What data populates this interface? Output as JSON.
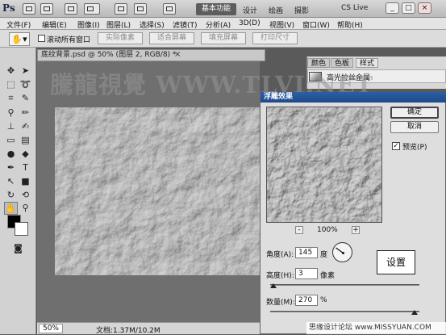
{
  "app": {
    "logo": "Ps",
    "workspace_active": "基本功能",
    "workspace_links": [
      "设计",
      "绘画",
      "摄影"
    ],
    "cs_live": "CS Live"
  },
  "window_controls": [
    "_",
    "□",
    "×"
  ],
  "menu": [
    "文件(F)",
    "编辑(E)",
    "图像(I)",
    "图层(L)",
    "选择(S)",
    "滤镜(T)",
    "分析(A)",
    "3D(D)",
    "视图(V)",
    "窗口(W)",
    "帮助(H)"
  ],
  "options": {
    "scroll_all_label": "滚动所有窗口",
    "buttons": [
      "实际像素",
      "适合屏幕",
      "填充屏幕",
      "打印尺寸"
    ]
  },
  "document": {
    "tab_title": "底纹背景.psd @ 50% (图层 2, RGB/8) *",
    "close_glyph": "×",
    "zoom": "50%",
    "doc_info": "文档:1.37M/10.2M"
  },
  "panels": {
    "tabs": [
      "颜色",
      "色板",
      "样式"
    ],
    "preset_label": "高光拉丝金属"
  },
  "watermark": "騰龍視覺 WWW.TLVI.NET",
  "dialog": {
    "title": "浮雕效果",
    "ok": "确定",
    "cancel": "取消",
    "preview_label": "预览(P)",
    "preview_checked": "✓",
    "zoom_minus": "-",
    "zoom_plus": "+",
    "zoom_pct": "100%",
    "angle_label": "角度(A):",
    "angle_value": "145",
    "angle_unit": "度",
    "height_label": "高度(H):",
    "height_value": "3",
    "height_unit": "像素",
    "amount_label": "数量(M):",
    "amount_value": "270",
    "amount_unit": "%",
    "callout": "设置"
  },
  "footer_watermark": "思缘设计论坛 www.MISSYUAN.COM",
  "icons": [
    "hand-tool-icon",
    "move-icon",
    "marquee-icon",
    "lasso-icon",
    "crop-icon",
    "eyedropper-icon",
    "brush-icon",
    "stamp-icon",
    "eraser-icon",
    "gradient-icon",
    "dodge-icon",
    "pen-icon",
    "type-icon",
    "path-select-icon",
    "shape-icon",
    "3d-icon",
    "zoom-icon"
  ]
}
